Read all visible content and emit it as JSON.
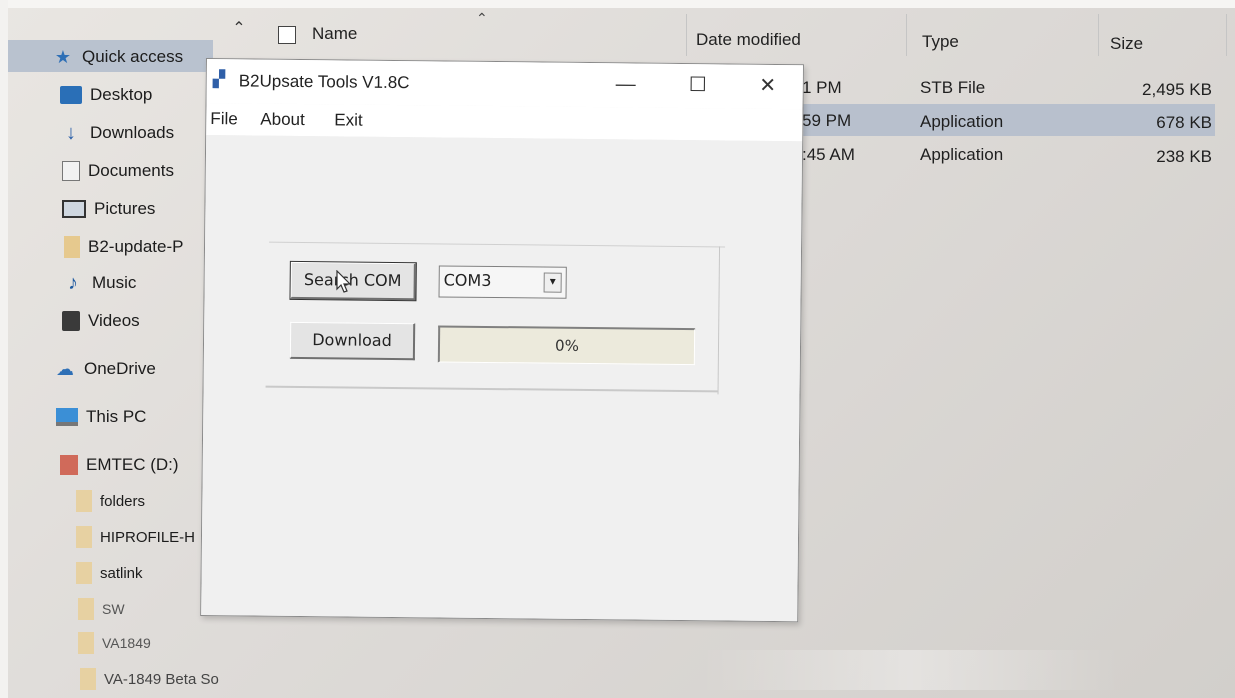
{
  "explorer": {
    "sidebar": {
      "items": [
        {
          "label": "Quick access",
          "icon": "star-icon",
          "selected": true
        },
        {
          "label": "Desktop",
          "icon": "desktop-icon"
        },
        {
          "label": "Downloads",
          "icon": "download-icon"
        },
        {
          "label": "Documents",
          "icon": "document-icon"
        },
        {
          "label": "Pictures",
          "icon": "pictures-icon"
        },
        {
          "label": "B2-update-P",
          "icon": "folder-icon"
        },
        {
          "label": "Music",
          "icon": "music-icon"
        },
        {
          "label": "Videos",
          "icon": "videos-icon"
        },
        {
          "label": "OneDrive",
          "icon": "cloud-icon"
        },
        {
          "label": "This PC",
          "icon": "computer-icon"
        },
        {
          "label": "EMTEC (D:)",
          "icon": "drive-icon"
        },
        {
          "label": "folders",
          "icon": "folder-icon"
        },
        {
          "label": "HIPROFILE-H",
          "icon": "folder-icon"
        },
        {
          "label": "satlink",
          "icon": "folder-icon"
        },
        {
          "label": "SW",
          "icon": "folder-icon"
        },
        {
          "label": "VA1849",
          "icon": "folder-icon"
        },
        {
          "label": "VA-1849 Beta So",
          "icon": "folder-icon"
        }
      ]
    },
    "columns": {
      "name": "Name",
      "date_modified": "Date modified",
      "type": "Type",
      "size": "Size"
    },
    "rows": [
      {
        "date_fragment": "1 PM",
        "type": "STB File",
        "size": "2,495 KB",
        "selected": false
      },
      {
        "date_fragment": "59 PM",
        "type": "Application",
        "size": "678 KB",
        "selected": true
      },
      {
        "date_fragment": ":45 AM",
        "type": "Application",
        "size": "238 KB",
        "selected": false
      }
    ]
  },
  "dialog": {
    "title": "B2Upsate Tools V1.8C",
    "controls": {
      "minimize": "—",
      "maximize": "☐",
      "close": "✕"
    },
    "menu": {
      "file": "File",
      "about": "About",
      "exit": "Exit"
    },
    "search_button": "Search COM",
    "com_selected": "COM3",
    "download_button": "Download",
    "progress_text": "0%",
    "progress_fraction": 0
  },
  "colors": {
    "selection": "#b8c0cd",
    "dialog_bg": "#f0f0f0",
    "accent_blue": "#2e6fb6"
  }
}
